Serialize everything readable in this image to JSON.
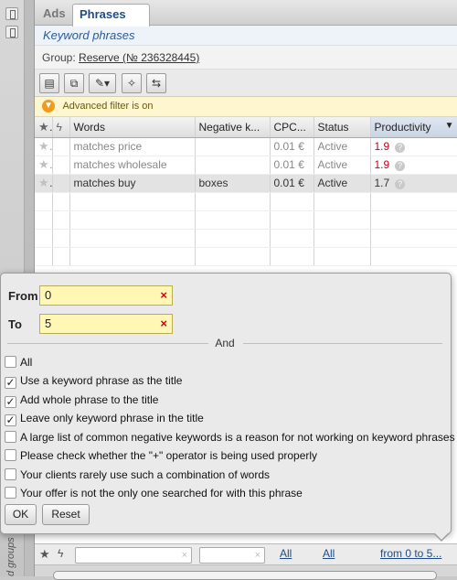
{
  "tabs": {
    "ads": "Ads",
    "phrases": "Phrases"
  },
  "panel_title": "Keyword phrases",
  "group": {
    "label": "Group:",
    "name": "Reserve (№ 236328445)"
  },
  "filter_bar": {
    "text": "Advanced filter is on"
  },
  "table": {
    "columns": [
      "Words",
      "Negative k...",
      "CPC...",
      "Status",
      "Productivity"
    ],
    "rows": [
      {
        "words": "matches price",
        "negative": "",
        "cpc": "0.01 €",
        "status": "Active",
        "productivity": "1.9"
      },
      {
        "words": "matches wholesale",
        "negative": "",
        "cpc": "0.01 €",
        "status": "Active",
        "productivity": "1.9"
      },
      {
        "words": "matches buy",
        "negative": "boxes",
        "cpc": "0.01 €",
        "status": "Active",
        "productivity": "1.7"
      }
    ]
  },
  "popup": {
    "from_label": "From",
    "from_value": "0",
    "to_label": "To",
    "to_value": "5",
    "and_label": "And",
    "options": [
      {
        "label": "All",
        "checked": false
      },
      {
        "label": "Use a keyword phrase as the title",
        "checked": true
      },
      {
        "label": "Add whole phrase to the title",
        "checked": true
      },
      {
        "label": "Leave only keyword phrase in the title",
        "checked": true
      },
      {
        "label": "A large list of common negative keywords is a reason for not working on keyword phrases",
        "checked": false
      },
      {
        "label": "Please check whether the \"+\" operator is being used properly",
        "checked": false
      },
      {
        "label": "Your clients rarely use such a combination of words",
        "checked": false
      },
      {
        "label": "Your offer is not the only one searched for with this phrase",
        "checked": false
      }
    ],
    "ok_label": "OK",
    "reset_label": "Reset"
  },
  "bottom_filters": {
    "col4": "All",
    "col5": "All",
    "col6": "from 0 to 5..."
  },
  "rail_text": "d groups"
}
